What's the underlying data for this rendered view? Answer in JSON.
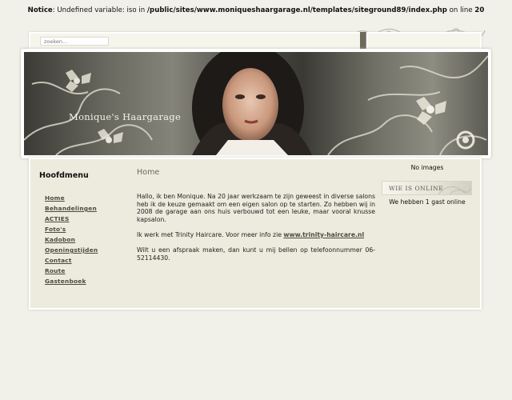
{
  "notice": {
    "label": "Notice",
    "text_before_path": ": Undefined variable: iso in ",
    "path": "/public/sites/www.moniqueshaargarage.nl/templates/siteground89/index.php",
    "text_before_line": " on line ",
    "line": "20"
  },
  "search": {
    "placeholder": "zoeken..."
  },
  "header": {
    "site_title": "Monique's Haargarage"
  },
  "menu": {
    "title": "Hoofdmenu",
    "items": [
      {
        "label": "Home"
      },
      {
        "label": "Behandelingen"
      },
      {
        "label": "ACTIES"
      },
      {
        "label": "Foto's"
      },
      {
        "label": "Kadobon"
      },
      {
        "label": "Openingstijden"
      },
      {
        "label": "Contact"
      },
      {
        "label": "Route"
      },
      {
        "label": "Gastenboek"
      }
    ]
  },
  "content": {
    "heading": "Home",
    "p1": "Hallo, ik ben Monique. Na 20 jaar werkzaam te zijn geweest in diverse salons heb ik de keuze gemaakt om een eigen salon op te starten. Zo hebben wij in 2008 de garage aan ons huis verbouwd tot een leuke, maar vooral knusse kapsalon.",
    "p2_text": "Ik werk met Trinity Haircare.  Voor meer info zie ",
    "p2_link": "www.trinity-haircare.nl",
    "p3": "Wilt u een afspraak maken, dan kunt u mij bellen op telefoonnummer 06-52114430."
  },
  "right": {
    "no_images": "No images",
    "wie_is_online": "WIE IS ONLINE",
    "online_text": "We hebben 1 gast online"
  },
  "colors": {
    "background": "#f2f1e9",
    "panel": "#ecebdd",
    "link": "#4d4a3c"
  }
}
